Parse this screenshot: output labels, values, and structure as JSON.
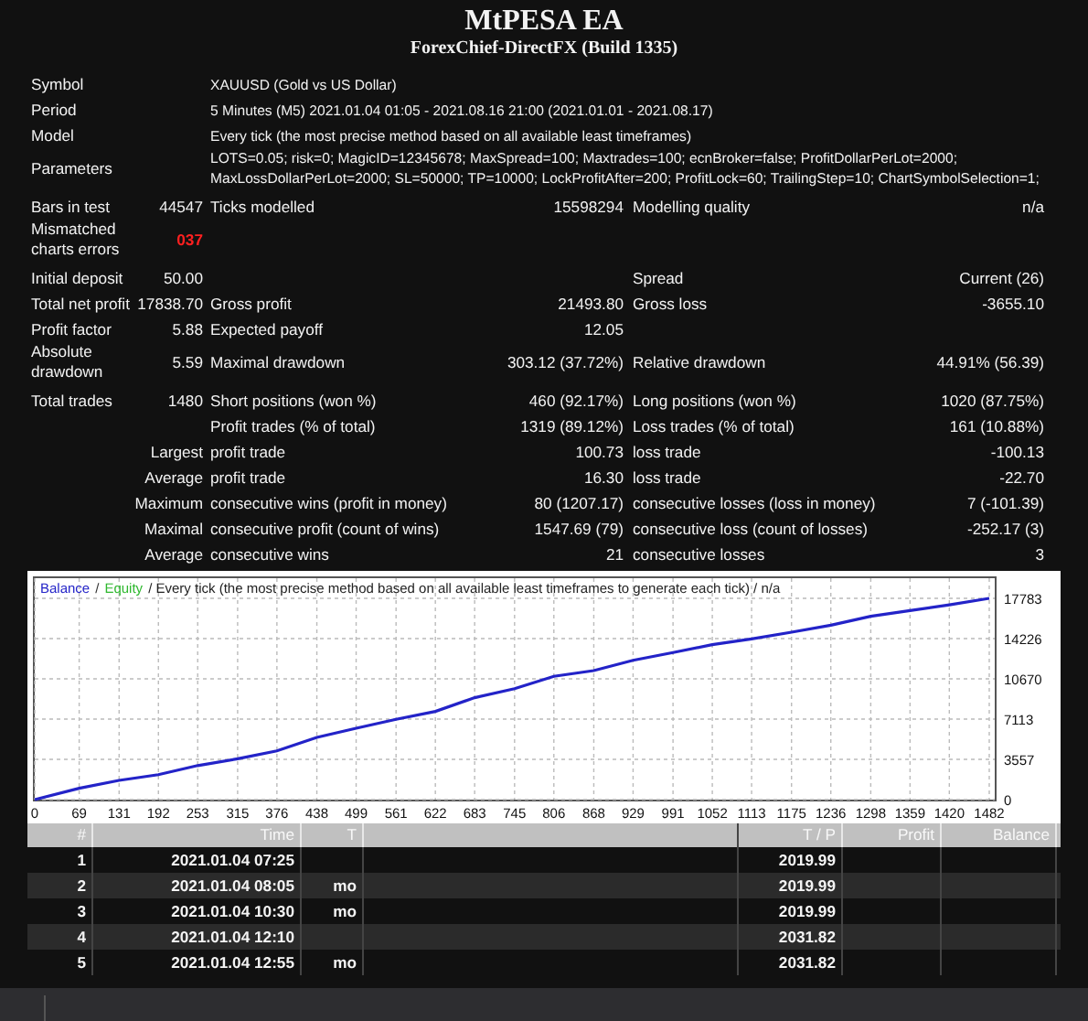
{
  "title": "MtPESA EA",
  "subtitle": "ForexChief-DirectFX (Build 1335)",
  "stats": [
    {
      "kind": "info",
      "label": "Symbol",
      "text": "XAUUSD (Gold vs US Dollar)"
    },
    {
      "kind": "info",
      "label": "Period",
      "text": "5 Minutes (M5) 2021.01.04 01:05 - 2021.08.16 21:00 (2021.01.01 - 2021.08.17)"
    },
    {
      "kind": "info",
      "label": "Model",
      "text": "Every tick (the most precise method based on all available least timeframes)"
    },
    {
      "kind": "info",
      "label": "Parameters",
      "text": "LOTS=0.05; risk=0; MagicID=12345678; MaxSpread=100; Maxtrades=100; ecnBroker=false; ProfitDollarPerLot=2000; MaxLossDollarPerLot=2000; SL=50000; TP=10000; LockProfitAfter=200; ProfitLock=60; TrailingStep=10; ChartSymbolSelection=1;"
    },
    {
      "kind": "gap"
    },
    {
      "kind": "stat",
      "label": "Bars in test",
      "value": "44547",
      "label2": "Ticks modelled",
      "value2": "15598294",
      "label3": "Modelling quality",
      "value3": "n/a"
    },
    {
      "kind": "error",
      "label": "Mismatched charts errors",
      "value": "037"
    },
    {
      "kind": "gap"
    },
    {
      "kind": "stat",
      "label": "Initial deposit",
      "value": "50.00",
      "label3": "Spread",
      "value3": "Current (26)"
    },
    {
      "kind": "stat",
      "label": "Total net profit",
      "value": "17838.70",
      "label2": "Gross profit",
      "value2": "21493.80",
      "label3": "Gross loss",
      "value3": "-3655.10"
    },
    {
      "kind": "stat",
      "label": "Profit factor",
      "value": "5.88",
      "label2": "Expected payoff",
      "value2": "12.05"
    },
    {
      "kind": "stat",
      "label": "Absolute drawdown",
      "value": "5.59",
      "label2": "Maximal drawdown",
      "value2": "303.12 (37.72%)",
      "label3": "Relative drawdown",
      "value3": "44.91% (56.39)"
    },
    {
      "kind": "gap"
    },
    {
      "kind": "stat",
      "label": "Total trades",
      "value": "1480",
      "label2": "Short positions (won %)",
      "value2": "460 (92.17%)",
      "label3": "Long positions (won %)",
      "value3": "1020 (87.75%)"
    },
    {
      "kind": "stat",
      "label2": "Profit trades (% of total)",
      "value2": "1319 (89.12%)",
      "label3": "Loss trades (% of total)",
      "value3": "161 (10.88%)"
    },
    {
      "kind": "stat",
      "value": "Largest",
      "label2": "profit trade",
      "value2": "100.73",
      "label3": "loss trade",
      "value3": "-100.13"
    },
    {
      "kind": "stat",
      "value": "Average",
      "label2": "profit trade",
      "value2": "16.30",
      "label3": "loss trade",
      "value3": "-22.70"
    },
    {
      "kind": "stat",
      "value": "Maximum",
      "label2": "consecutive wins (profit in money)",
      "value2": "80 (1207.17)",
      "label3": "consecutive losses (loss in money)",
      "value3": "7 (-101.39)"
    },
    {
      "kind": "stat",
      "value": "Maximal",
      "label2": "consecutive profit (count of wins)",
      "value2": "1547.69 (79)",
      "label3": "consecutive loss (count of losses)",
      "value3": "-252.17 (3)"
    },
    {
      "kind": "stat",
      "value": "Average",
      "label2": "consecutive wins",
      "value2": "21",
      "label3": "consecutive losses",
      "value3": "3"
    }
  ],
  "chart": {
    "caption": [
      {
        "text": "/",
        "color": "#333333"
      },
      {
        "text": "Equity",
        "color": "#2fb82f"
      },
      {
        "text": "/ Every tick (the most precise method based on all available least timeframes to generate each tick) / n/a",
        "color": "#222222"
      }
    ],
    "chart_data": {
      "type": "line",
      "x": [
        0,
        69,
        131,
        192,
        253,
        315,
        376,
        438,
        499,
        561,
        622,
        683,
        745,
        806,
        868,
        929,
        991,
        1052,
        1113,
        1175,
        1236,
        1298,
        1359,
        1420,
        1482
      ],
      "series": [
        {
          "name": "Balance",
          "color": "#2323c8",
          "values": [
            0,
            1000,
            1700,
            2200,
            3000,
            3600,
            4300,
            5500,
            6300,
            7100,
            7800,
            9000,
            9800,
            10900,
            11400,
            12300,
            13000,
            13700,
            14200,
            14800,
            15400,
            16200,
            16700,
            17200,
            17780
          ]
        }
      ],
      "xlim": [
        0,
        1482
      ],
      "ylim": [
        0,
        17783
      ],
      "grid": true,
      "xticks": [
        0,
        69,
        131,
        192,
        253,
        315,
        376,
        438,
        499,
        561,
        622,
        683,
        745,
        806,
        868,
        929,
        991,
        1052,
        1113,
        1175,
        1236,
        1298,
        1359,
        1420,
        1482
      ],
      "yticks": [
        0,
        3557,
        7113,
        10670,
        14226,
        17783
      ]
    }
  },
  "trades": {
    "columns": [
      "#",
      "Time",
      "T",
      "T / P",
      "Profit",
      "Balance"
    ],
    "rows": [
      {
        "cells": [
          "1",
          "2021.01.04 07:25",
          null,
          "2019.99",
          null,
          null
        ]
      },
      {
        "cells": [
          "2",
          "2021.01.04 08:05",
          "mo",
          "2019.99",
          null,
          null
        ]
      },
      {
        "cells": [
          "3",
          "2021.01.04 10:30",
          "mo",
          "2019.99",
          null,
          null
        ]
      },
      {
        "cells": [
          "4",
          "2021.01.04 12:10",
          null,
          "2031.82",
          null,
          null
        ]
      },
      {
        "cells": [
          "5",
          "2021.01.04 12:55",
          "mo",
          "2031.82",
          null,
          null
        ]
      }
    ]
  }
}
